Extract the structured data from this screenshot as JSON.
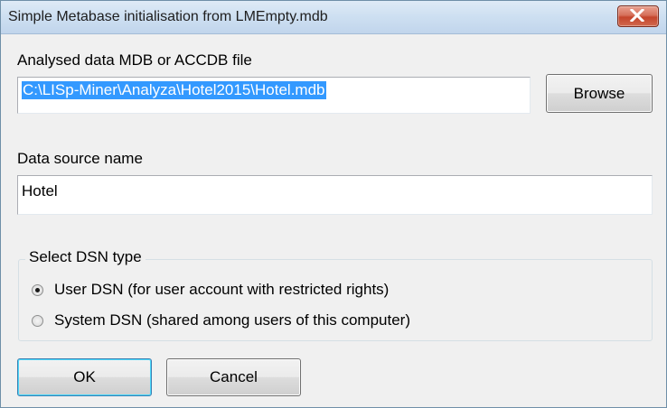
{
  "window": {
    "title": "Simple Metabase initialisation from LMEmpty.mdb"
  },
  "mdb_file": {
    "label": "Analysed data MDB or ACCDB file",
    "value": "C:\\LISp-Miner\\Analyza\\Hotel2015\\Hotel.mdb",
    "browse_label": "Browse"
  },
  "dsn_name": {
    "label": "Data source name",
    "value": "Hotel"
  },
  "dsn_type": {
    "legend": "Select DSN type",
    "options": [
      {
        "label": "User DSN (for user account with restricted rights)",
        "selected": true
      },
      {
        "label": "System DSN (shared among users of this computer)",
        "selected": false
      }
    ]
  },
  "buttons": {
    "ok_label": "OK",
    "cancel_label": "Cancel"
  },
  "colors": {
    "selection": "#3399ff",
    "close_button": "#c4442b"
  },
  "icons": {
    "close": "close-icon"
  }
}
